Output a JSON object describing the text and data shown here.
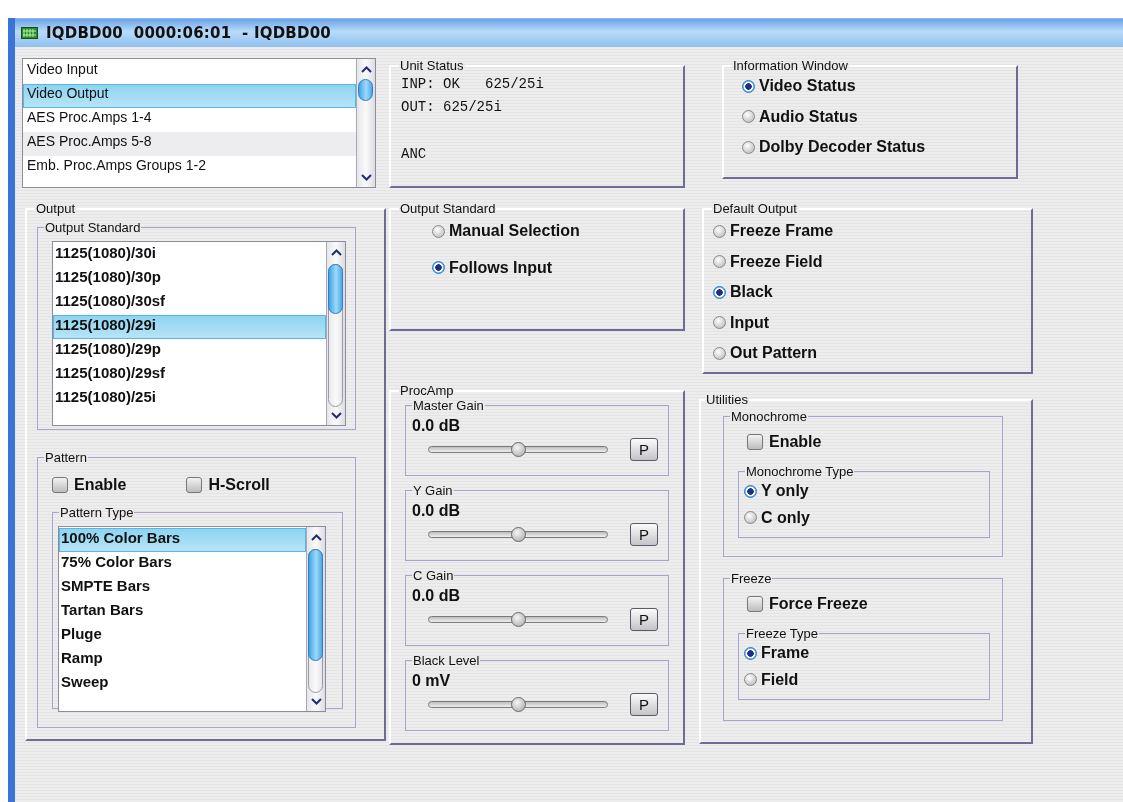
{
  "window": {
    "title": "IQDBD00  0000:06:01  - IQDBD00"
  },
  "nav_list": {
    "items": [
      {
        "label": "Video Input",
        "selected": false
      },
      {
        "label": "Video Output",
        "selected": true
      },
      {
        "label": "AES Proc.Amps 1-4",
        "selected": false
      },
      {
        "label": "AES Proc.Amps 5-8",
        "selected": false
      },
      {
        "label": "Emb. Proc.Amps Groups 1-2",
        "selected": false
      }
    ]
  },
  "unit_status": {
    "title": "Unit Status",
    "lines": [
      "INP: OK   625/25i",
      "OUT: 625/25i"
    ],
    "anc": "ANC"
  },
  "information_window": {
    "title": "Information Window",
    "options": [
      {
        "label": "Video Status",
        "selected": true
      },
      {
        "label": "Audio Status",
        "selected": false
      },
      {
        "label": "Dolby Decoder Status",
        "selected": false
      }
    ]
  },
  "output": {
    "title": "Output",
    "output_standard": {
      "title": "Output Standard",
      "items": [
        {
          "label": "1125(1080)/30i",
          "selected": false
        },
        {
          "label": "1125(1080)/30p",
          "selected": false
        },
        {
          "label": "1125(1080)/30sf",
          "selected": false
        },
        {
          "label": "1125(1080)/29i",
          "selected": true
        },
        {
          "label": "1125(1080)/29p",
          "selected": false
        },
        {
          "label": "1125(1080)/29sf",
          "selected": false
        },
        {
          "label": "1125(1080)/25i",
          "selected": false
        }
      ]
    },
    "pattern": {
      "title": "Pattern",
      "checks": [
        {
          "label": "Enable",
          "checked": false
        },
        {
          "label": "H-Scroll",
          "checked": false
        }
      ],
      "pattern_type": {
        "title": "Pattern Type",
        "items": [
          {
            "label": "100% Color Bars",
            "selected": true
          },
          {
            "label": "75% Color Bars",
            "selected": false
          },
          {
            "label": "SMPTE Bars",
            "selected": false
          },
          {
            "label": "Tartan Bars",
            "selected": false
          },
          {
            "label": "Pluge",
            "selected": false
          },
          {
            "label": "Ramp",
            "selected": false
          },
          {
            "label": "Sweep",
            "selected": false
          }
        ]
      }
    }
  },
  "output_standard_mode": {
    "title": "Output Standard",
    "options": [
      {
        "label": "Manual Selection",
        "selected": false
      },
      {
        "label": "Follows Input",
        "selected": true
      }
    ]
  },
  "default_output": {
    "title": "Default Output",
    "options": [
      {
        "label": "Freeze Frame",
        "selected": false
      },
      {
        "label": "Freeze Field",
        "selected": false
      },
      {
        "label": "Black",
        "selected": true
      },
      {
        "label": "Input",
        "selected": false
      },
      {
        "label": "Out Pattern",
        "selected": false
      }
    ]
  },
  "procamp": {
    "title": "ProcAmp",
    "controls": [
      {
        "title": "Master Gain",
        "reading": "0.0 dB",
        "level": 0.5,
        "button": "P"
      },
      {
        "title": "Y Gain",
        "reading": "0.0 dB",
        "level": 0.5,
        "button": "P"
      },
      {
        "title": "C Gain",
        "reading": "0.0 dB",
        "level": 0.5,
        "button": "P"
      },
      {
        "title": "Black Level",
        "reading": "0 mV",
        "level": 0.5,
        "button": "P"
      }
    ]
  },
  "utilities": {
    "title": "Utilities",
    "monochrome": {
      "title": "Monochrome",
      "enable": {
        "label": "Enable",
        "checked": false
      },
      "type": {
        "title": "Monochrome Type",
        "options": [
          {
            "label": "Y only",
            "selected": true
          },
          {
            "label": "C only",
            "selected": false
          }
        ]
      }
    },
    "freeze": {
      "title": "Freeze",
      "force": {
        "label": "Force Freeze",
        "checked": false
      },
      "type": {
        "title": "Freeze Type",
        "options": [
          {
            "label": "Frame",
            "selected": true
          },
          {
            "label": "Field",
            "selected": false
          }
        ]
      }
    }
  }
}
